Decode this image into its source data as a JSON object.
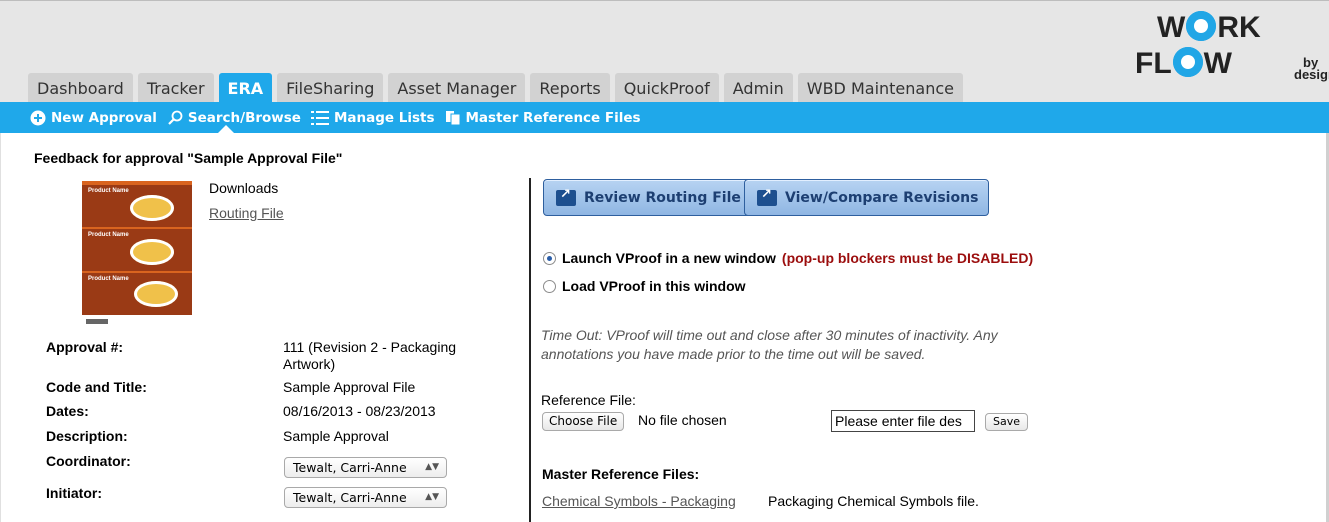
{
  "logo": {
    "line1": "W",
    "line1_end": "RK",
    "line2": "FL",
    "line2_end": "W",
    "tagline_by": "by",
    "tagline_design": "design"
  },
  "tabs": [
    {
      "label": "Dashboard"
    },
    {
      "label": "Tracker"
    },
    {
      "label": "ERA",
      "active": true
    },
    {
      "label": "FileSharing"
    },
    {
      "label": "Asset Manager"
    },
    {
      "label": "Reports"
    },
    {
      "label": "QuickProof"
    },
    {
      "label": "Admin"
    },
    {
      "label": "WBD Maintenance"
    }
  ],
  "subnav": {
    "new_approval": "New Approval",
    "search_browse": "Search/Browse",
    "manage_lists": "Manage Lists",
    "master_reference_files": "Master Reference Files"
  },
  "feedback_title": "Feedback for approval \"Sample Approval File\"",
  "thumbnail": {
    "label1": "Product Name",
    "label2": "Product Name",
    "label3": "Product Name"
  },
  "downloads": {
    "heading": "Downloads",
    "routing_file": "Routing File"
  },
  "details": {
    "approval_label": "Approval #:",
    "approval_value": "111 (Revision 2 - Packaging Artwork)",
    "code_label": "Code and Title:",
    "code_value": "Sample Approval File",
    "dates_label": "Dates:",
    "dates_value": "08/16/2013 - 08/23/2013",
    "description_label": "Description:",
    "description_value": "Sample Approval",
    "coordinator_label": "Coordinator:",
    "coordinator_value": "Tewalt, Carri-Anne",
    "initiator_label": "Initiator:",
    "initiator_value": "Tewalt, Carri-Anne"
  },
  "actions": {
    "review_routing": "Review Routing File",
    "view_compare": "View/Compare Revisions"
  },
  "launch": {
    "new_window": "Launch VProof in a new window",
    "new_window_warning": "(pop-up blockers must be DISABLED)",
    "this_window": "Load VProof in this window",
    "selected": "new_window"
  },
  "timeout_note": "Time Out: VProof will time out and close after 30 minutes of inactivity. Any annotations you have made prior to the time out will be saved.",
  "reference": {
    "label": "Reference File:",
    "choose_button": "Choose File",
    "no_file": "No file chosen",
    "description_value": "Please enter file des",
    "save_button": "Save"
  },
  "master_reference": {
    "heading": "Master Reference Files:",
    "link": "Chemical Symbols - Packaging",
    "description": "Packaging Chemical Symbols file."
  },
  "colors": {
    "accent": "#1fa8ea",
    "warning": "#9b0d0d",
    "button_text": "#1d3f72"
  }
}
